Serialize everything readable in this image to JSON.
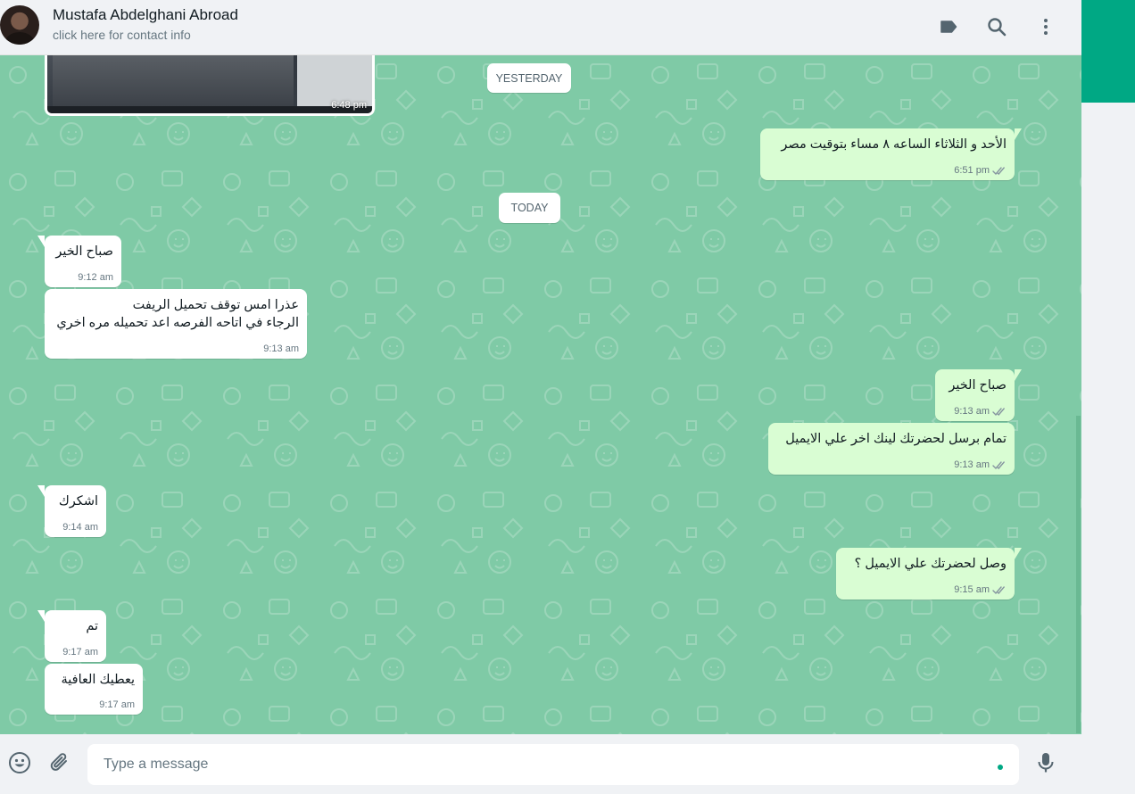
{
  "header": {
    "contact_name": "Mustafa Abdelghani Abroad",
    "contact_subtitle": "click here for contact info",
    "icons": [
      "label-icon",
      "search-icon",
      "menu-icon"
    ]
  },
  "media_message": {
    "time": "6:48 pm"
  },
  "dividers": {
    "yesterday": "YESTERDAY",
    "today": "TODAY"
  },
  "messages": [
    {
      "dir": "out",
      "lines": [
        "الأحد و الثلاثاء الساعه ٨ مساء بتوقيت مصر"
      ],
      "time": "6:51 pm",
      "status": "read"
    },
    {
      "dir": "in",
      "lines": [
        "صباح الخير"
      ],
      "time": "9:12 am"
    },
    {
      "dir": "in",
      "lines": [
        "عذرا امس توقف تحميل الريفت",
        "الرجاء في اتاحه الفرصه اعد تحميله مره اخري"
      ],
      "time": "9:13 am"
    },
    {
      "dir": "out",
      "lines": [
        "صباح الخير"
      ],
      "time": "9:13 am",
      "status": "read"
    },
    {
      "dir": "out",
      "lines": [
        "تمام برسل لحضرتك لينك اخر علي الايميل"
      ],
      "time": "9:13 am",
      "status": "read"
    },
    {
      "dir": "in",
      "lines": [
        "اشكرك"
      ],
      "time": "9:14 am"
    },
    {
      "dir": "out",
      "lines": [
        "وصل لحضرتك علي الايميل ؟"
      ],
      "time": "9:15 am",
      "status": "read"
    },
    {
      "dir": "in",
      "lines": [
        "تم"
      ],
      "time": "9:17 am"
    },
    {
      "dir": "in",
      "lines": [
        "يعطيك العافية"
      ],
      "time": "9:17 am"
    }
  ],
  "footer": {
    "placeholder": "Type a message",
    "icons": [
      "emoji-icon",
      "attach-icon",
      "mic-icon"
    ]
  },
  "colors": {
    "chat_background": "#7fcaa6",
    "outgoing_bubble": "#d9fdd3",
    "incoming_bubble": "#ffffff",
    "accent": "#00a884"
  }
}
